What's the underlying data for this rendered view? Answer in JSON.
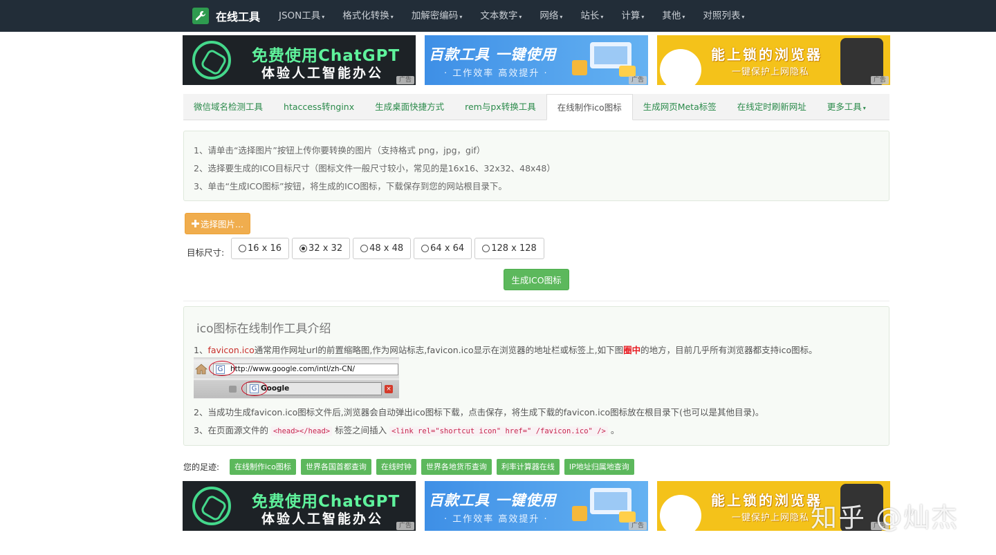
{
  "navbar": {
    "brand": "在线工具",
    "items": [
      {
        "label": "JSON工具"
      },
      {
        "label": "格式化转换"
      },
      {
        "label": "加解密编码"
      },
      {
        "label": "文本数字"
      },
      {
        "label": "网络"
      },
      {
        "label": "站长"
      },
      {
        "label": "计算"
      },
      {
        "label": "其他"
      },
      {
        "label": "对照列表"
      }
    ],
    "caret": "▾"
  },
  "ads": {
    "label": "广告",
    "chatgpt": {
      "title": "免费使用ChatGPT",
      "subtitle": "体验人工智能办公"
    },
    "tools": {
      "title": "百款工具 一键使用",
      "subtitle": "· 工作效率 高效提升 ·"
    },
    "browser": {
      "title": "能上锁的浏览器",
      "subtitle": "一键保护上网隐私"
    }
  },
  "tabs": [
    {
      "label": "微信域名检测工具"
    },
    {
      "label": "htaccess转nginx"
    },
    {
      "label": "生成桌面快捷方式"
    },
    {
      "label": "rem与px转换工具"
    },
    {
      "label": "在线制作ico图标",
      "active": true
    },
    {
      "label": "生成网页Meta标签"
    },
    {
      "label": "在线定时刷新网址"
    },
    {
      "label": "更多工具"
    }
  ],
  "instructions": [
    "1、请单击“选择图片”按钮上传你要转换的图片（支持格式 png，jpg，gif）",
    "2、选择要生成的ICO目标尺寸（图标文件一般尺寸较小，常见的是16x16、32x32、48x48）",
    "3、单击“生成ICO图标”按钮，将生成的ICO图标，下载保存到您的网站根目录下。"
  ],
  "form": {
    "choose_button": "选择图片...",
    "size_label": "目标尺寸:",
    "sizes": [
      {
        "label": "16 x 16",
        "selected": false
      },
      {
        "label": "32 x 32",
        "selected": true
      },
      {
        "label": "48 x 48",
        "selected": false
      },
      {
        "label": "64 x 64",
        "selected": false
      },
      {
        "label": "128 x 128",
        "selected": false
      }
    ],
    "generate_button": "生成ICO图标"
  },
  "intro": {
    "title": "ico图标在线制作工具介绍",
    "line1": {
      "prefix": "1、",
      "link": "favicon.ico",
      "text_a": "通常用作网址url的前置缩略图,作为网站标志,favicon.ico显示在浏览器的地址栏或标签上,如下图",
      "circled": "圈中",
      "text_b": "的地方，目前几乎所有浏览器都支持ico图标。"
    },
    "browser_example": {
      "url": "http://www.google.com/intl/zh-CN/",
      "tab_title": "Google",
      "favicon_letter": "G",
      "close_glyph": "×"
    },
    "line2": "2、当成功生成favicon.ico图标文件后,浏览器会自动弹出ico图标下载，点击保存，将生成下载的favicon.ico图标放在根目录下(也可以是其他目录)。",
    "line3": {
      "prefix": "3、在页面源文件的 ",
      "code1": "<head></head>",
      "middle": " 标签之间插入 ",
      "code2": "<link rel=\"shortcut icon\" href=\" /favicon.ico\" />",
      "suffix": " 。"
    }
  },
  "footprints": {
    "label": "您的足迹:",
    "items": [
      {
        "label": "在线制作ico图标"
      },
      {
        "label": "世界各国首都查询"
      },
      {
        "label": "在线时钟"
      },
      {
        "label": "世界各地货币查询"
      },
      {
        "label": "利率计算器在线"
      },
      {
        "label": "IP地址归属地查询"
      }
    ]
  },
  "watermark": "知乎 @灿杰",
  "colors": {
    "navbar": "#222d38",
    "primary_green": "#5cb85c",
    "warning_orange": "#f0ad4e",
    "link_red": "#c9302c",
    "tab_green": "#2a8a4a"
  }
}
